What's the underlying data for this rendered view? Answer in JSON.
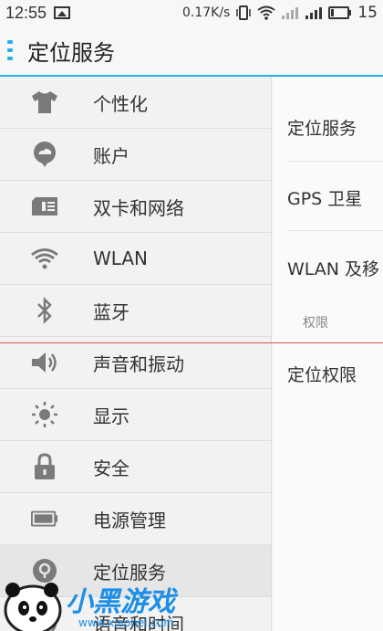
{
  "status": {
    "time": "12:55",
    "speed": "0.17K/s",
    "battery": "15"
  },
  "header": {
    "title": "定位服务"
  },
  "sidebar": {
    "items": [
      {
        "label": "个性化",
        "icon": "shirt-icon"
      },
      {
        "label": "账户",
        "icon": "account-icon"
      },
      {
        "label": "双卡和网络",
        "icon": "sim-card-icon"
      },
      {
        "label": "WLAN",
        "icon": "wifi-icon"
      },
      {
        "label": "蓝牙",
        "icon": "bluetooth-icon"
      },
      {
        "label": "声音和振动",
        "icon": "speaker-icon"
      },
      {
        "label": "显示",
        "icon": "brightness-icon"
      },
      {
        "label": "安全",
        "icon": "lock-icon"
      },
      {
        "label": "电源管理",
        "icon": "battery-icon"
      },
      {
        "label": "定位服务",
        "icon": "location-icon",
        "active": true
      },
      {
        "label": "语音和时间",
        "icon": "language-icon"
      }
    ]
  },
  "detail": {
    "rows": [
      "定位服务",
      "GPS 卫星",
      "WLAN 及移"
    ],
    "section_title": "权限",
    "permission_row": "定位权限"
  },
  "watermark": {
    "text": "小黑游戏",
    "url": "www.xiaohei.com"
  },
  "colors": {
    "accent": "#27b0e3",
    "divider_red": "#d9534f"
  }
}
